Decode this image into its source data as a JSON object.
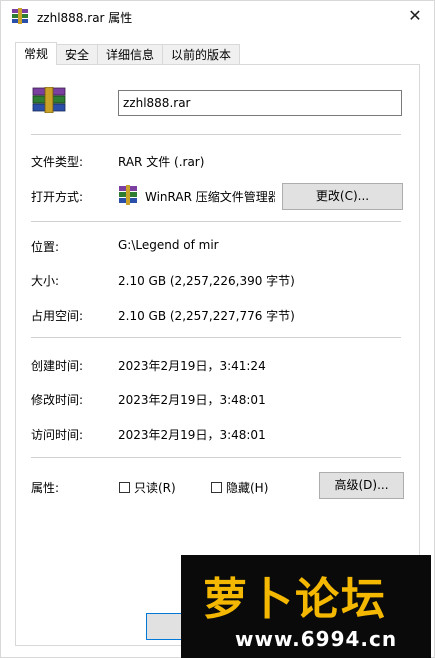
{
  "window": {
    "title": "zzhl888.rar 属性",
    "close_glyph": "✕",
    "icon": "winrar-archive-icon"
  },
  "tabs": [
    {
      "label": "常规",
      "active": true
    },
    {
      "label": "安全",
      "active": false
    },
    {
      "label": "详细信息",
      "active": false
    },
    {
      "label": "以前的版本",
      "active": false
    }
  ],
  "general": {
    "file_name": "zzhl888.rar",
    "file_type_label": "文件类型:",
    "file_type_value": "RAR 文件 (.rar)",
    "open_with_label": "打开方式:",
    "open_with_value": "WinRAR 压缩文件管理器",
    "change_button": "更改(C)...",
    "location_label": "位置:",
    "location_value": "G:\\Legend of mir",
    "size_label": "大小:",
    "size_value": "2.10 GB (2,257,226,390 字节)",
    "size_on_disk_label": "占用空间:",
    "size_on_disk_value": "2.10 GB (2,257,227,776 字节)",
    "created_label": "创建时间:",
    "created_value": "2023年2月19日，3:41:24",
    "modified_label": "修改时间:",
    "modified_value": "2023年2月19日，3:48:01",
    "accessed_label": "访问时间:",
    "accessed_value": "2023年2月19日，3:48:01",
    "attributes_label": "属性:",
    "readonly_label": "只读(R)",
    "readonly_checked": false,
    "hidden_label": "隐藏(H)",
    "hidden_checked": false,
    "advanced_button": "高级(D)..."
  },
  "banner": {
    "title": "萝卜论坛",
    "url": "www.6994.cn"
  },
  "colors": {
    "button_bg": "#e1e1e1",
    "button_border": "#adadad",
    "separator": "#d0d0d0",
    "banner_bg": "#0a0a0a",
    "banner_title": "#f5b800"
  }
}
